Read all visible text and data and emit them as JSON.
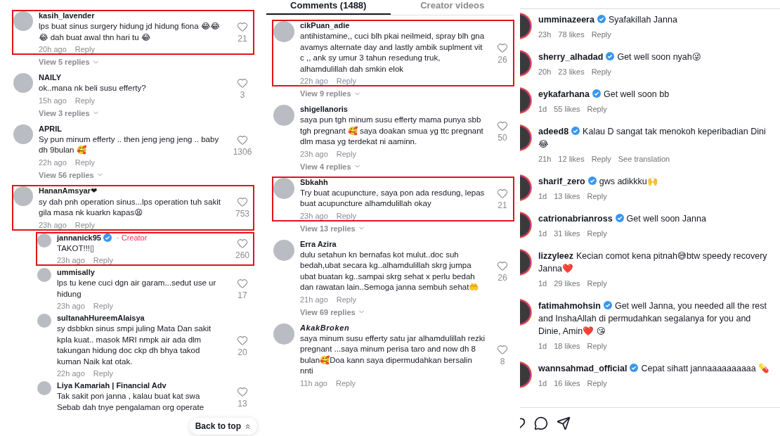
{
  "panels": [
    {
      "kind": "tiktok",
      "comments": [
        {
          "user": "kasih_lavender",
          "italic": false,
          "text": "lps buat sinus surgery hidung jd hidung fiona 😂😂 😂 dah buat awal thn hari tu 😂",
          "time": "20h ago",
          "reply": "Reply",
          "likes": "21",
          "view_replies": "View 5 replies",
          "highlighted": true
        },
        {
          "user": "NAILY",
          "italic": false,
          "text": "ok..mana nk beli susu efferty?",
          "time": "15h ago",
          "reply": "Reply",
          "likes": "3",
          "view_replies": "View 3 replies",
          "highlighted": false
        },
        {
          "user": "APRIL",
          "italic": false,
          "text": "Sy pun minum efferty .. then jeng jeng jeng .. baby dh 9bulan 🥰",
          "time": "22h ago",
          "reply": "Reply",
          "likes": "1306",
          "view_replies": "View 56 replies",
          "highlighted": false
        },
        {
          "user": "HananAmsyar❤",
          "italic": false,
          "text": "sy dah pnh operation sinus...lps operation tuh sakit gila masa nk kuarkn kapas😫",
          "time": "23h ago",
          "reply": "Reply",
          "likes": "753",
          "highlighted": true,
          "replies": [
            {
              "user": "jannanick95",
              "verified": true,
              "badge": "· Creator",
              "text": "TAKOT!!!▯",
              "time": "23h ago",
              "reply": "Reply",
              "likes": "260",
              "highlighted": true
            },
            {
              "user": "ummisally",
              "verified": false,
              "text": "lps tu kene cuci dgn air garam...sedut use ur hidung",
              "time": "23h ago",
              "reply": "Reply",
              "likes": "17",
              "highlighted": false
            },
            {
              "user": "sultanahHureemAlaisya",
              "verified": false,
              "text": "sy dsbbkn sinus smpi juling Mata Dan sakit kpla kuat.. masok MRI nmpk air ada dlm takungan hidung doc ckp dh bhya takod kuman Naik kat otak.",
              "time": "22h ago",
              "reply": "Reply",
              "likes": "20",
              "highlighted": false
            },
            {
              "user": "Liya Kamariah | Financial Adv",
              "verified": false,
              "text": "Tak sakit pon janna , kalau buat kat swa\nSebab dah tnye pengalaman org operate",
              "likes": "13",
              "highlighted": false
            }
          ]
        }
      ],
      "back_to_top": "Back to top"
    },
    {
      "kind": "tiktok",
      "tabs": [
        {
          "label": "Comments (1488)",
          "selected": true
        },
        {
          "label": "Creator videos",
          "selected": false
        }
      ],
      "comments": [
        {
          "user": "cikPuan_adie",
          "italic": false,
          "text": "antihistamine,, cuci blh pkai neilmeid, spray blh gna avamys alternate day and lastly ambik suplment vit c ,, ank sy umur 3 tahun resedung truk, alhamdulillah dah smkin elok",
          "time": "22h ago",
          "reply": "Reply",
          "likes": "26",
          "view_replies": "View 9 replies",
          "highlighted": true
        },
        {
          "user": "shigellanoris",
          "italic": false,
          "text": "saya pun tgh minum susu efferty mama punya sbb tgh pregnant 🥰 saya doakan smua yg ttc pregnant dlm masa yg terdekat ni aaminn.",
          "time": "23h ago",
          "reply": "Reply",
          "likes": "50",
          "view_replies": "View 4 replies",
          "highlighted": false
        },
        {
          "user": "Sbkahh",
          "italic": false,
          "text": "Try buat acupuncture, saya pon ada resdung, lepas buat acupuncture alhamdulillah okay",
          "time": "23h ago",
          "reply": "Reply",
          "likes": "21",
          "view_replies": "View 13 replies",
          "highlighted": true
        },
        {
          "user": "Erra Azira",
          "italic": false,
          "text": "dulu setahun kn bernafas kot mulut..doc suh bedah,ubat secara kg..alhamdulillah skrg jumpa ubat buatan kg..sampai skrg sehat x perlu bedah dan rawatan lain..Semoga janna sembuh sehat🤲",
          "time": "21h ago",
          "reply": "Reply",
          "likes": "26",
          "view_replies": "View 69 replies",
          "highlighted": false
        },
        {
          "user": "AkakBroken",
          "italic": true,
          "text": "saya minum susu efferty satu jar alhamdulillah rezki pregnant ...saya minum perisa taro and now dh 8 bulan🥰Doa kann saya dipermudahkan bersalin nnti",
          "time": "11h ago",
          "reply": "Reply",
          "likes": "8",
          "highlighted": false
        }
      ]
    },
    {
      "kind": "instagram",
      "comments": [
        {
          "user": "umminazeera",
          "verified": true,
          "text": "Syafakillah Janna",
          "time": "23h",
          "likes": "78 likes",
          "reply": "Reply"
        },
        {
          "user": "sherry_alhadad",
          "verified": true,
          "text": "Get well soon nyah😜",
          "time": "20h",
          "likes": "23 likes",
          "reply": "Reply"
        },
        {
          "user": "eykafarhana",
          "verified": true,
          "text": "Get well soon bb",
          "time": "1d",
          "likes": "55 likes",
          "reply": "Reply"
        },
        {
          "user": "adeed8",
          "verified": true,
          "text": "Kalau D sangat tak menokoh keperibadian Dini 😂",
          "time": "21h",
          "likes": "12 likes",
          "reply": "Reply",
          "translate": "See translation"
        },
        {
          "user": "sharif_zero",
          "verified": true,
          "text": "gws adikkku🙌",
          "time": "1d",
          "likes": "13 likes",
          "reply": "Reply"
        },
        {
          "user": "catrionabrianross",
          "verified": true,
          "text": "Get well soon Janna",
          "time": "1d",
          "likes": "31 likes",
          "reply": "Reply"
        },
        {
          "user": "lizzyleez",
          "verified": false,
          "text": "Kecian comot kena pitnah😅btw speedy recovery Janna❤️",
          "time": "1d",
          "likes": "29 likes",
          "reply": "Reply"
        },
        {
          "user": "fatimahmohsin",
          "verified": true,
          "text": "Get well Janna, you needed all the rest and InshaAllah di permudahkan segalanya for you and Dinie, Amin❤️ 😘",
          "time": "1d",
          "likes": "18 likes",
          "reply": "Reply"
        },
        {
          "user": "wannsahmad_official",
          "verified": true,
          "text": "Cepat sihatt jannaaaaaaaaaa 💊",
          "time": "1d",
          "likes": "16 likes",
          "reply": "Reply"
        }
      ]
    }
  ]
}
